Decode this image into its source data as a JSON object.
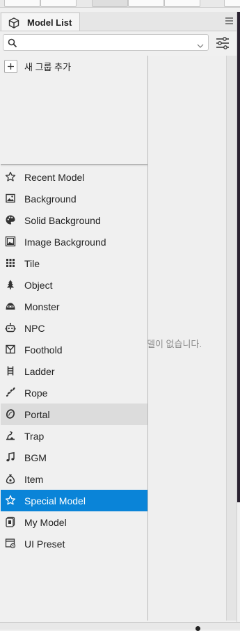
{
  "panel": {
    "tab_title": "Model List",
    "tab_icon": "cube-icon",
    "menu_icon": "hamburger-menu-icon"
  },
  "search": {
    "value": "",
    "placeholder": "",
    "search_icon": "magnifier-icon",
    "dropdown_icon": "chevron-down-icon",
    "filter_icon": "filter-sliders-icon"
  },
  "groups": {
    "add_group_label": "새 그룹 추가"
  },
  "categories": [
    {
      "label": "Recent Model",
      "icon": "star-outline-icon",
      "state": "normal"
    },
    {
      "label": "Background",
      "icon": "picture-icon",
      "state": "normal"
    },
    {
      "label": "Solid Background",
      "icon": "palette-icon",
      "state": "normal"
    },
    {
      "label": "Image Background",
      "icon": "image-frame-icon",
      "state": "normal"
    },
    {
      "label": "Tile",
      "icon": "grid-icon",
      "state": "normal"
    },
    {
      "label": "Object",
      "icon": "tree-icon",
      "state": "normal"
    },
    {
      "label": "Monster",
      "icon": "slime-icon",
      "state": "normal"
    },
    {
      "label": "NPC",
      "icon": "robot-icon",
      "state": "normal"
    },
    {
      "label": "Foothold",
      "icon": "foothold-icon",
      "state": "normal"
    },
    {
      "label": "Ladder",
      "icon": "ladder-icon",
      "state": "normal"
    },
    {
      "label": "Rope",
      "icon": "rope-icon",
      "state": "normal"
    },
    {
      "label": "Portal",
      "icon": "portal-ring-icon",
      "state": "hover"
    },
    {
      "label": "Trap",
      "icon": "trap-icon",
      "state": "normal"
    },
    {
      "label": "BGM",
      "icon": "music-note-icon",
      "state": "normal"
    },
    {
      "label": "Item",
      "icon": "money-bag-icon",
      "state": "normal"
    },
    {
      "label": "Special Model",
      "icon": "star-outline-icon",
      "state": "selected"
    },
    {
      "label": "My Model",
      "icon": "my-model-icon",
      "state": "normal"
    },
    {
      "label": "UI Preset",
      "icon": "ui-preset-icon",
      "state": "normal"
    }
  ],
  "content": {
    "empty_message": "델이 없습니다."
  },
  "colors": {
    "selection": "#0a84d8",
    "hover": "#dcdcdc",
    "panel_bg": "#f0f0f0"
  }
}
